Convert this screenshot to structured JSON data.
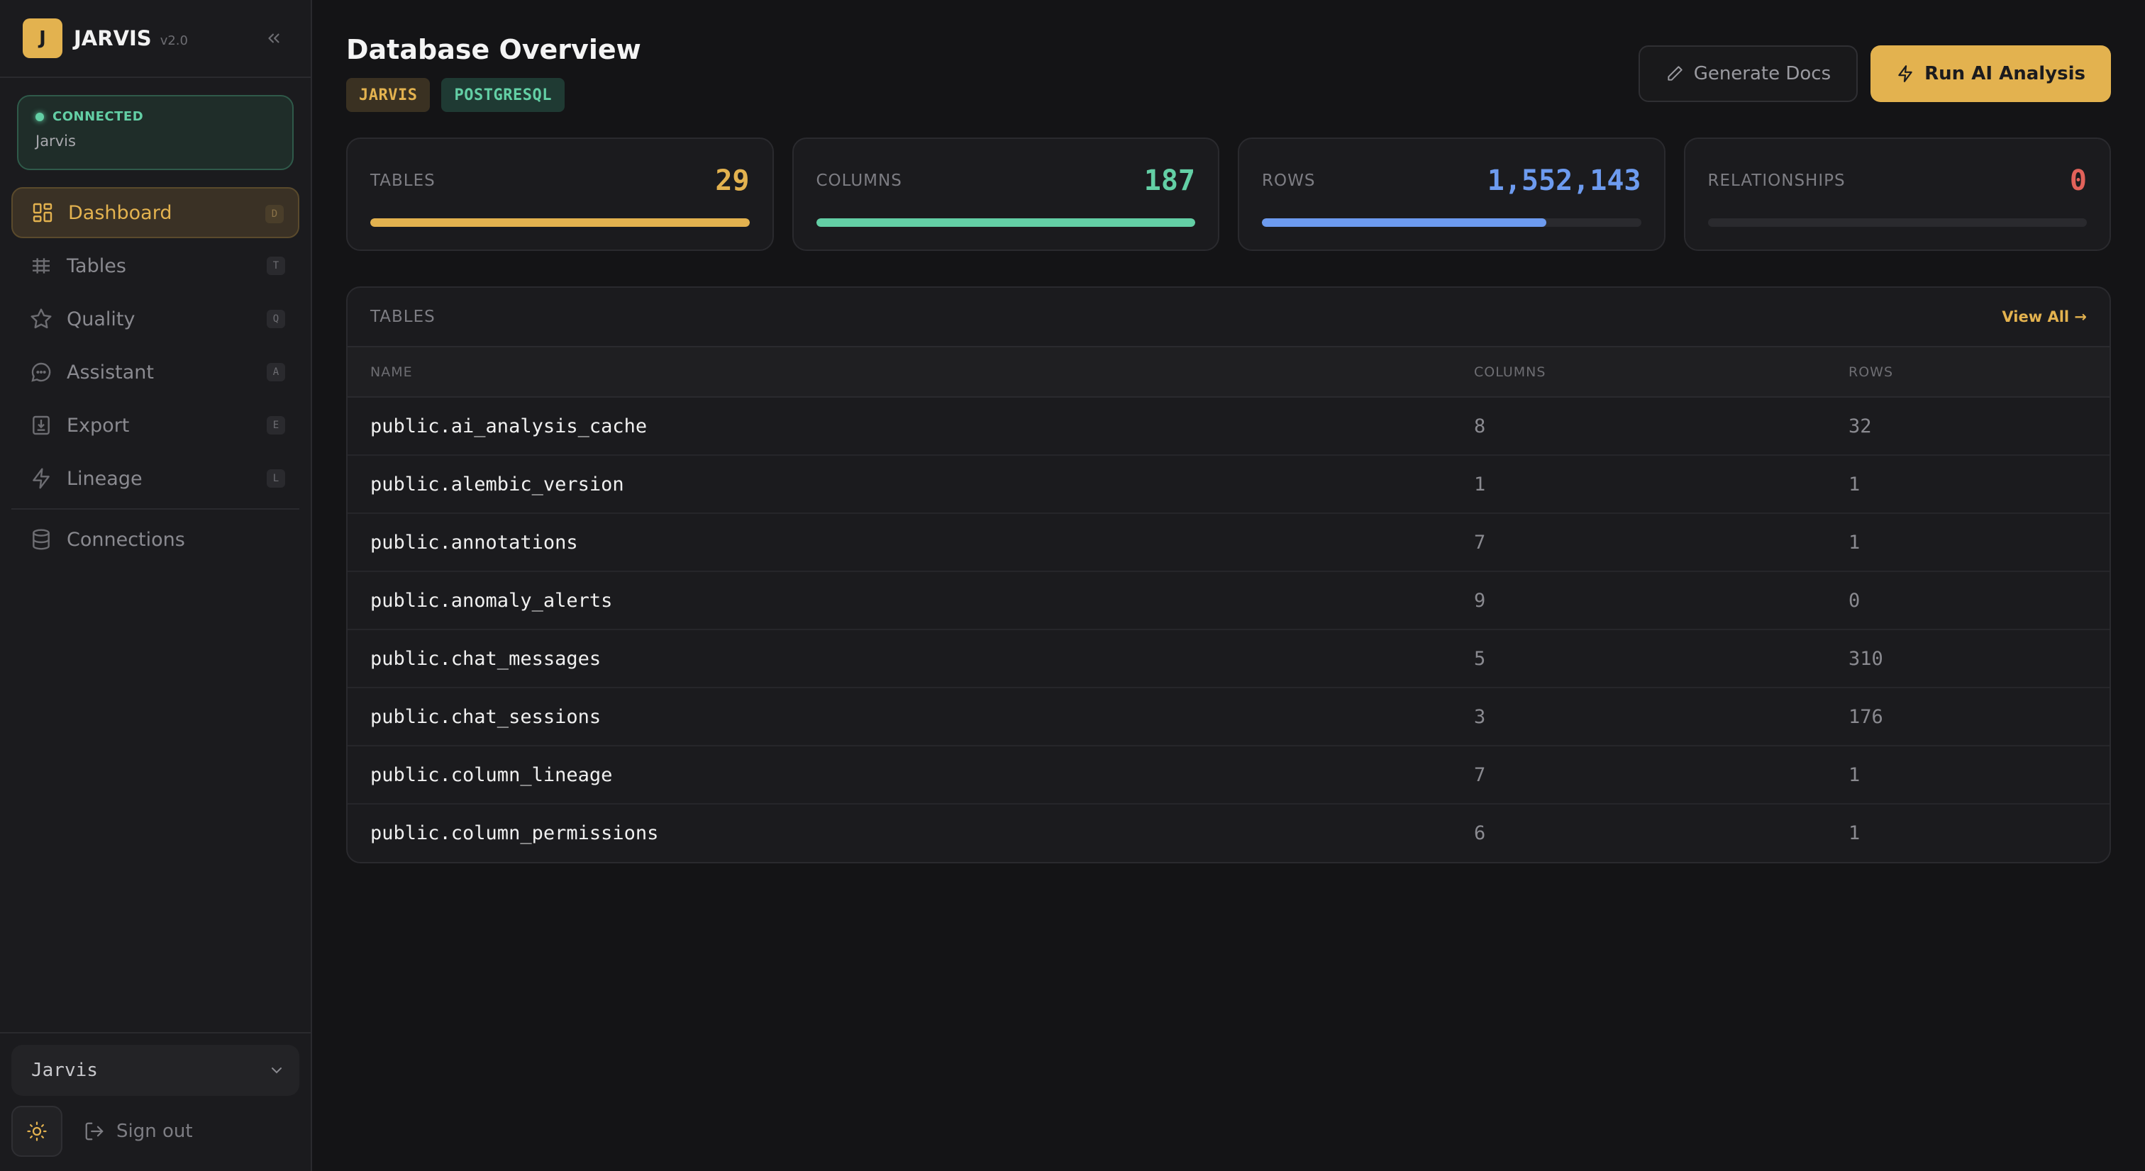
{
  "brand": {
    "logo": "J",
    "name": "JARVIS",
    "version": "v2.0"
  },
  "connection": {
    "status": "CONNECTED",
    "name": "Jarvis",
    "color": "#63cfa5"
  },
  "nav": {
    "items": [
      {
        "label": "Dashboard",
        "key": "D",
        "icon": "dashboard-icon",
        "active": true
      },
      {
        "label": "Tables",
        "key": "T",
        "icon": "tables-icon"
      },
      {
        "label": "Quality",
        "key": "Q",
        "icon": "star-icon"
      },
      {
        "label": "Assistant",
        "key": "A",
        "icon": "chat-icon"
      },
      {
        "label": "Export",
        "key": "E",
        "icon": "export-icon"
      },
      {
        "label": "Lineage",
        "key": "L",
        "icon": "bolt-icon"
      }
    ],
    "connections": {
      "label": "Connections",
      "icon": "database-icon"
    }
  },
  "footer": {
    "db_selected": "Jarvis",
    "signout_label": "Sign out"
  },
  "header": {
    "title": "Database Overview",
    "tags": [
      "JARVIS",
      "POSTGRESQL"
    ],
    "generate_docs_label": "Generate Docs",
    "run_ai_label": "Run AI Analysis"
  },
  "stats": [
    {
      "label": "TABLES",
      "value": "29",
      "color": "#e3b24f",
      "fill": 1.0
    },
    {
      "label": "COLUMNS",
      "value": "187",
      "color": "#63cfa5",
      "fill": 1.0
    },
    {
      "label": "ROWS",
      "value": "1,552,143",
      "color": "#6d9bef",
      "fill": 0.75
    },
    {
      "label": "RELATIONSHIPS",
      "value": "0",
      "color": "#e2625a",
      "fill": 0
    }
  ],
  "tables_panel": {
    "title": "TABLES",
    "view_all": "View All →",
    "headers": [
      "NAME",
      "COLUMNS",
      "ROWS"
    ],
    "rows": [
      [
        "public.ai_analysis_cache",
        "8",
        "32"
      ],
      [
        "public.alembic_version",
        "1",
        "1"
      ],
      [
        "public.annotations",
        "7",
        "1"
      ],
      [
        "public.anomaly_alerts",
        "9",
        "0"
      ],
      [
        "public.chat_messages",
        "5",
        "310"
      ],
      [
        "public.chat_sessions",
        "3",
        "176"
      ],
      [
        "public.column_lineage",
        "7",
        "1"
      ],
      [
        "public.column_permissions",
        "6",
        "1"
      ]
    ]
  }
}
